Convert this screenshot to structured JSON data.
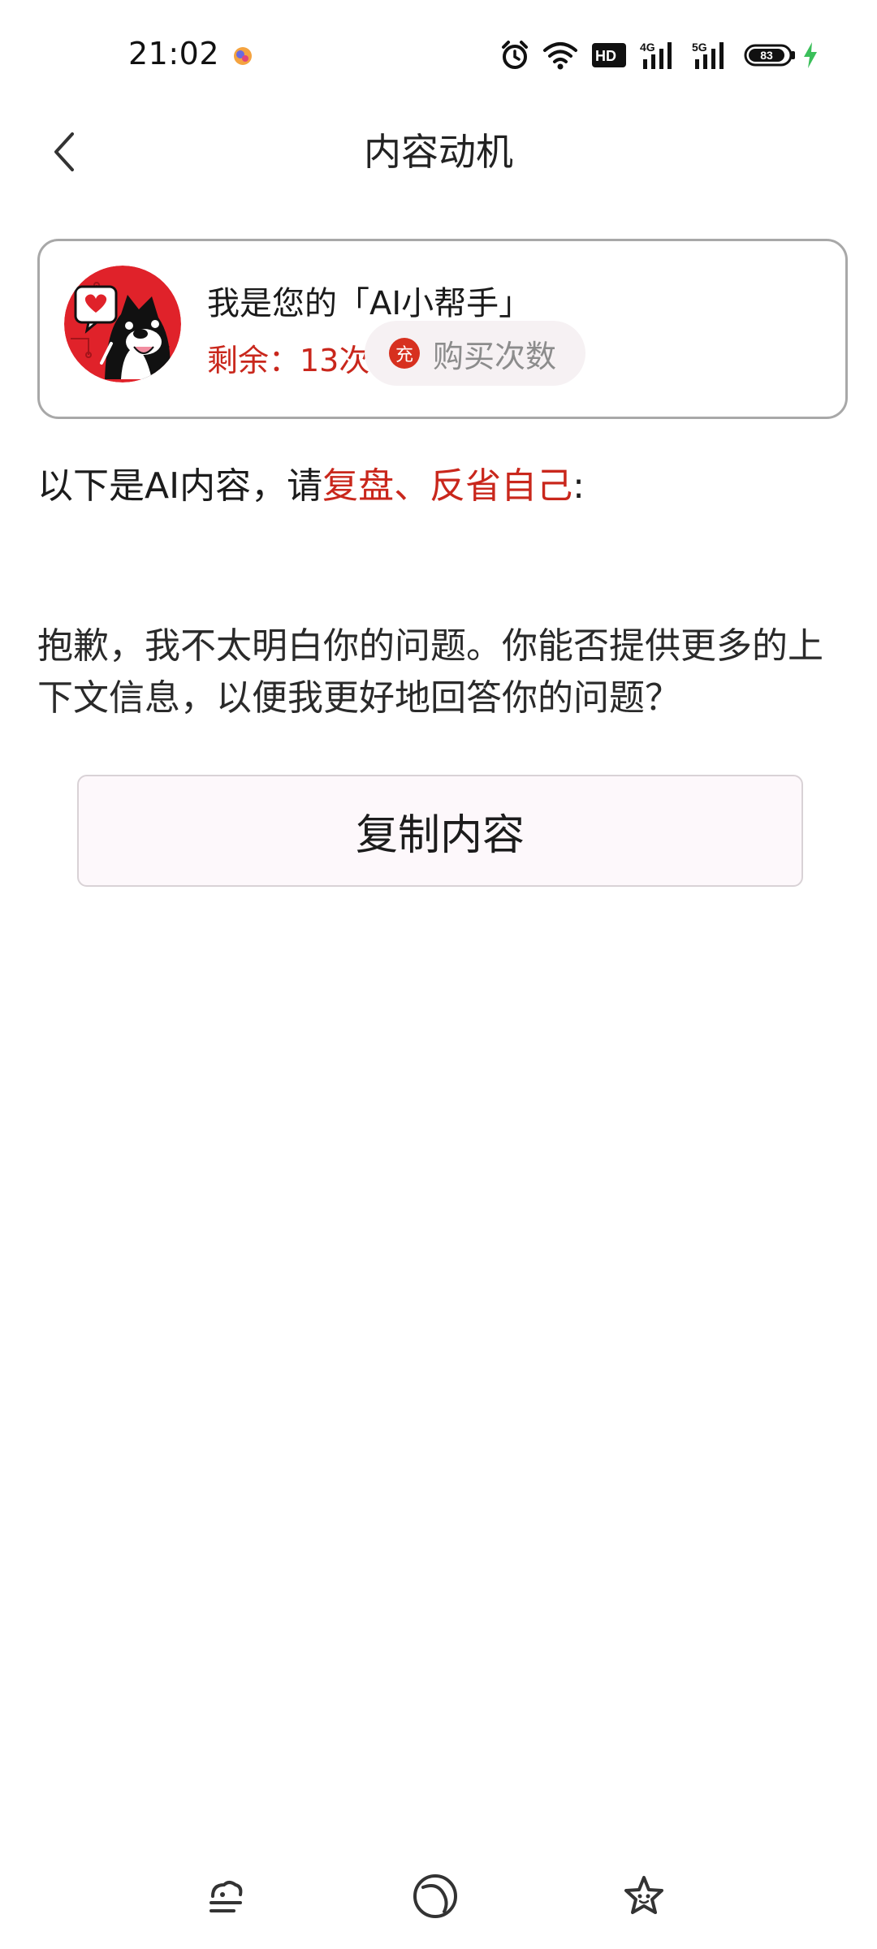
{
  "status_bar": {
    "time": "21:02",
    "icons": [
      "app-notification-icon",
      "alarm-icon",
      "wifi-icon",
      "hd-icon",
      "signal-4g-icon",
      "signal-5g-icon",
      "battery-icon",
      "charging-icon"
    ],
    "hd_label": "HD",
    "net1_label": "4G",
    "net2_label": "5G",
    "battery_level": "83",
    "charging_color": "#3bbf5a"
  },
  "header": {
    "title": "内容动机",
    "back_icon": "chevron-left-icon"
  },
  "ai_card": {
    "title": "我是您的「AI小帮手」",
    "remaining_label": "剩余：13次",
    "charge_icon_label": "充",
    "buy_label": "购买次数",
    "accent_color": "#c9271c"
  },
  "intro": {
    "prefix": "以下是AI内容，请",
    "highlight": "复盘、反省自己",
    "suffix": ":"
  },
  "answer": {
    "text": "抱歉，我不太明白你的问题。你能否提供更多的上下文信息，以便我更好地回答你的问题？"
  },
  "actions": {
    "copy_label": "复制内容"
  },
  "bottom_nav": {
    "items": [
      "menu-icon",
      "home-icon",
      "star-icon"
    ]
  }
}
